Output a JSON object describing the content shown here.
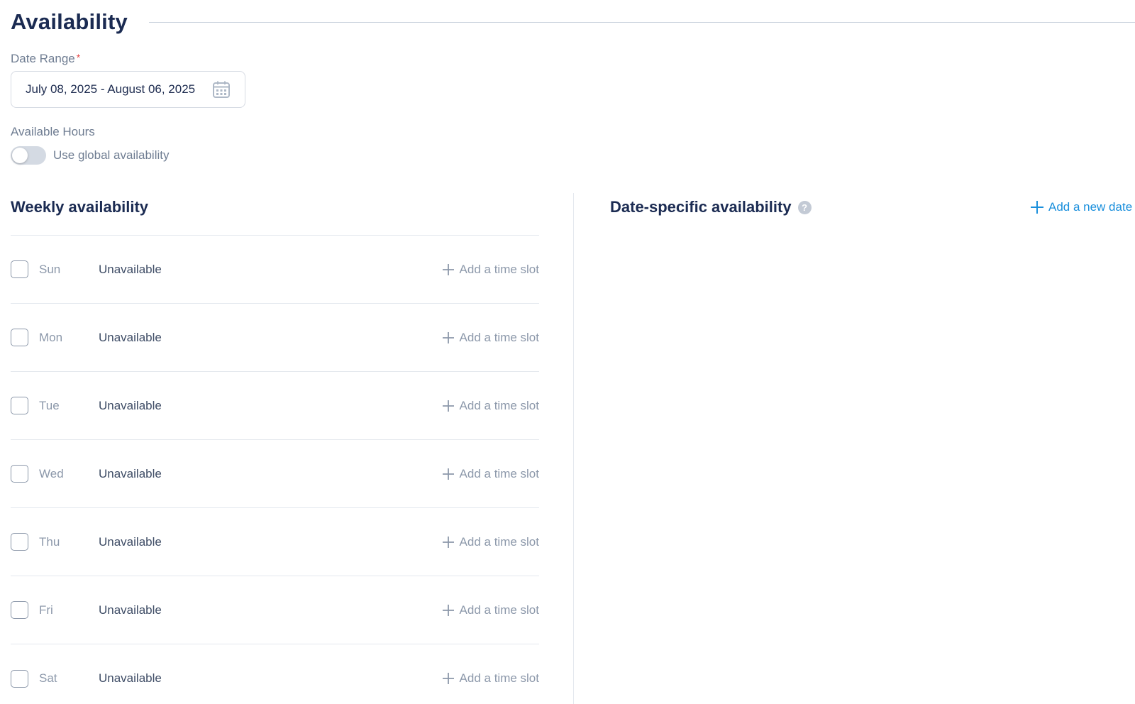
{
  "section": {
    "title": "Availability"
  },
  "date_range": {
    "label": "Date Range",
    "required_mark": "*",
    "value": "July 08, 2025 - August 06, 2025"
  },
  "available_hours": {
    "label": "Available Hours",
    "toggle_label": "Use global availability",
    "toggle_on": false
  },
  "weekly": {
    "title": "Weekly availability",
    "add_slot_label": "Add a time slot",
    "days": [
      {
        "name": "Sun",
        "status": "Unavailable",
        "checked": false
      },
      {
        "name": "Mon",
        "status": "Unavailable",
        "checked": false
      },
      {
        "name": "Tue",
        "status": "Unavailable",
        "checked": false
      },
      {
        "name": "Wed",
        "status": "Unavailable",
        "checked": false
      },
      {
        "name": "Thu",
        "status": "Unavailable",
        "checked": false
      },
      {
        "name": "Fri",
        "status": "Unavailable",
        "checked": false
      },
      {
        "name": "Sat",
        "status": "Unavailable",
        "checked": false
      }
    ]
  },
  "date_specific": {
    "title": "Date-specific availability",
    "help_glyph": "?",
    "add_label": "Add a new date"
  },
  "colors": {
    "primary_text": "#1b2b52",
    "muted_text": "#8c98aa",
    "accent": "#1a8fdc",
    "required": "#e54848"
  }
}
